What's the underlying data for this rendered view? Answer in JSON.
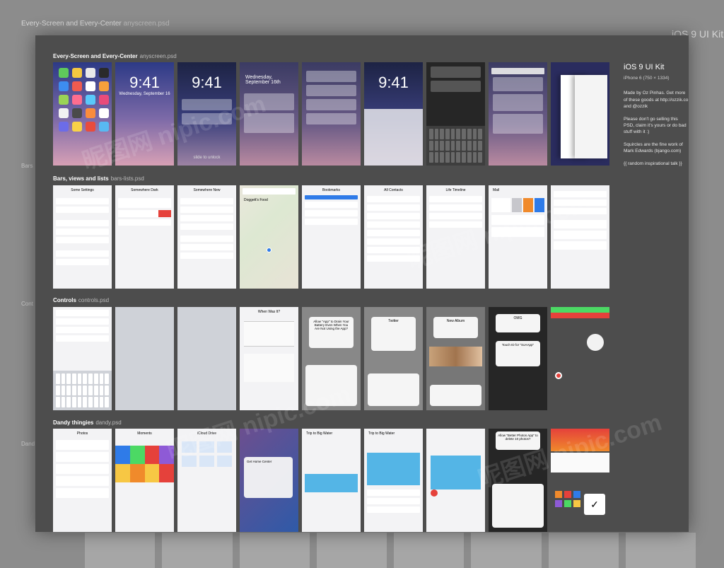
{
  "background": {
    "title": "Every-Screen and Every-Center",
    "title_suffix": "anyscreen.psd",
    "kit": "iOS 9 UI Kit",
    "side_labels": [
      "Bars",
      "Cont",
      "Dand"
    ]
  },
  "sections": [
    {
      "title": "Every-Screen and Every-Center",
      "file": "anyscreen.psd"
    },
    {
      "title": "Bars, views and lists",
      "file": "bars-lists.psd"
    },
    {
      "title": "Controls",
      "file": "controls.psd"
    },
    {
      "title": "Dandy thingies",
      "file": "dandy.psd"
    }
  ],
  "lockscreen": {
    "time": "9:41",
    "date": "Wednesday, September 16",
    "date_short": "Wednesday, September 16th",
    "slide": "slide to unlock"
  },
  "screens_row2": [
    "Some Settings",
    "Somewhere Dark",
    "Somewhere New",
    "Doggett's Food",
    "Bookmarks",
    "All Contacts",
    "Life Timeline",
    "Mail"
  ],
  "screens_row3": [
    "When Was It?",
    "Allow \"App\" to Drain Your Battery Even When You Are Not Using the App?",
    "Twitter",
    "New Album",
    "OMG",
    "Touch ID for \"SoAApp\""
  ],
  "screens_row4": [
    "Photos",
    "Moments",
    "iCloud Drive",
    "Get Home Center",
    "Trip to Big Water",
    "Trip to Big Water",
    "Allow \"Better Photos App\" to delete 10 photos?"
  ],
  "info": {
    "title": "iOS 9 UI Kit",
    "subtitle": "iPhone 6 (750 × 1334)",
    "p1": "Made by Oz Pinhas. Get more of these goods at http://ozzik.co and @ozzik",
    "p2": "Please don't go selling this PSD, claim it's yours or do bad stuff with it :)",
    "p3": "Squircles are the fine work of Mark Edwards (bjango.com)",
    "p4": "{{ random inspirational talk }}"
  },
  "watermark": "昵图网 nipic.com",
  "colors": {
    "board": "#4d4d4d",
    "accent": "#2f7be8",
    "red": "#e5413b",
    "green": "#4cd964",
    "orange": "#f08a2b"
  }
}
